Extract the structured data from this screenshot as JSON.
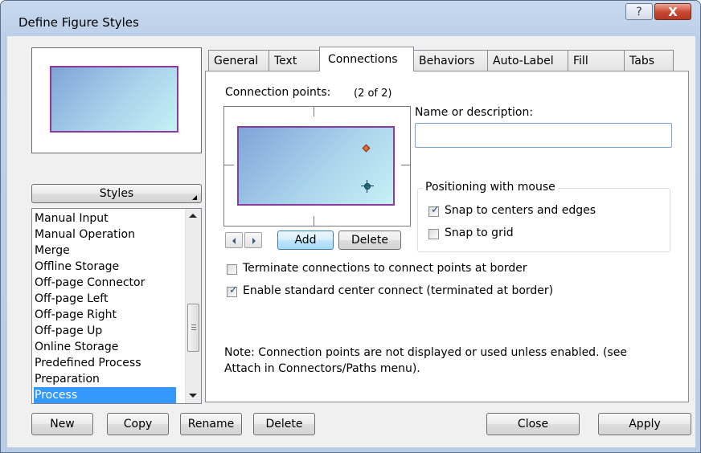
{
  "window": {
    "title": "Define Figure Styles",
    "help_glyph": "?",
    "close_glyph": "X"
  },
  "styles": {
    "button_label": "Styles",
    "list": [
      "Manual Input",
      "Manual Operation",
      "Merge",
      "Offline Storage",
      "Off-page Connector",
      "Off-page Left",
      "Off-page Right",
      "Off-page Up",
      "Online Storage",
      "Predefined Process",
      "Preparation",
      "Process"
    ],
    "selected": "Process"
  },
  "tabs": [
    {
      "label": "General",
      "active": false
    },
    {
      "label": "Text",
      "active": false
    },
    {
      "label": "Connections",
      "active": true
    },
    {
      "label": "Behaviors",
      "active": false
    },
    {
      "label": "Auto-Label",
      "active": false
    },
    {
      "label": "Fill",
      "active": false
    },
    {
      "label": "Tabs",
      "active": false
    }
  ],
  "connections": {
    "points_label": "Connection points:",
    "points_count": "(2 of 2)",
    "add_label": "Add",
    "delete_label": "Delete",
    "name_label": "Name or description:",
    "name_value": "",
    "positioning_legend": "Positioning with mouse",
    "snap_centers": {
      "label": "Snap to centers and edges",
      "checked": true
    },
    "snap_grid": {
      "label": "Snap to grid",
      "checked": false
    },
    "terminate": {
      "label": "Terminate connections to connect points at border",
      "checked": false
    },
    "enable_center": {
      "label": "Enable standard center connect (terminated at border)",
      "checked": true
    },
    "note_line1": "Note: Connection points are not displayed or used unless enabled.  (see",
    "note_line2": "Attach in Connectors/Paths menu)."
  },
  "bottom_buttons": {
    "new": "New",
    "copy": "Copy",
    "rename": "Rename",
    "delete": "Delete",
    "close": "Close",
    "apply": "Apply"
  },
  "colors": {
    "shape_border": "#8e3a9c",
    "shape_fill_start": "#7fa4d8",
    "shape_fill_end": "#c6f1f4",
    "selection": "#3399ff",
    "close_button": "#c8452d"
  }
}
